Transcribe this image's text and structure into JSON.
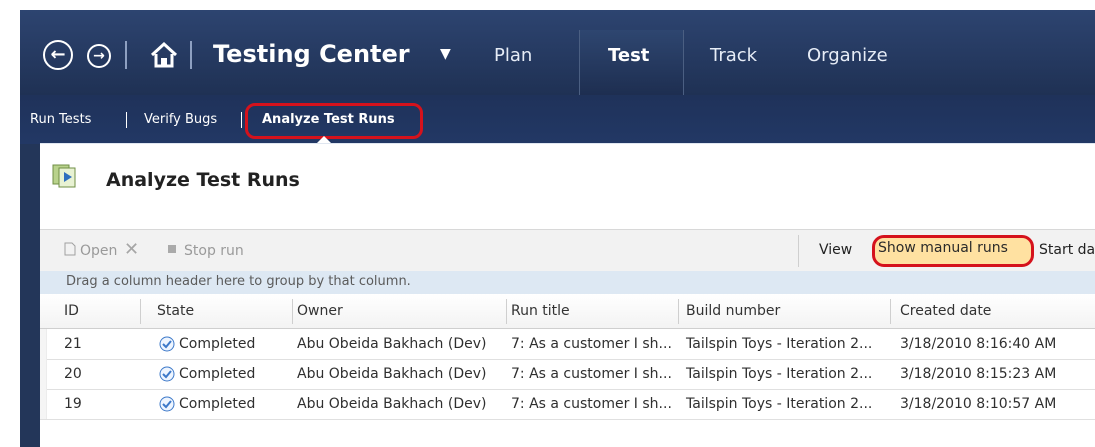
{
  "nav": {
    "title": "Testing Center",
    "tabs": [
      {
        "label": "Plan",
        "active": false
      },
      {
        "label": "Test",
        "active": true
      },
      {
        "label": "Track",
        "active": false
      },
      {
        "label": "Organize",
        "active": false
      }
    ]
  },
  "subnav": {
    "items": [
      {
        "label": "Run Tests",
        "active": false
      },
      {
        "label": "Verify Bugs",
        "active": false
      },
      {
        "label": "Analyze Test Runs",
        "active": true
      }
    ]
  },
  "page": {
    "title": "Analyze Test Runs"
  },
  "toolbar": {
    "open_label": "Open",
    "stop_label": "Stop run",
    "view_label": "View",
    "show_manual_label": "Show manual runs",
    "start_label": "Start dat"
  },
  "group_hint": "Drag a column header here to group by that column.",
  "table": {
    "columns": [
      "ID",
      "State",
      "Owner",
      "Run title",
      "Build number",
      "Created date"
    ],
    "rows": [
      {
        "id": "21",
        "state": "Completed",
        "owner": "Abu Obeida Bakhach (Dev)",
        "run_title": "7: As a customer I sh...",
        "build_number": "Tailspin Toys - Iteration 2...",
        "created_date": "3/18/2010 8:16:40 AM"
      },
      {
        "id": "20",
        "state": "Completed",
        "owner": "Abu Obeida Bakhach (Dev)",
        "run_title": "7: As a customer I sh...",
        "build_number": "Tailspin Toys - Iteration 2...",
        "created_date": "3/18/2010 8:15:23 AM"
      },
      {
        "id": "19",
        "state": "Completed",
        "owner": "Abu Obeida Bakhach (Dev)",
        "run_title": "7: As a customer I sh...",
        "build_number": "Tailspin Toys - Iteration 2...",
        "created_date": "3/18/2010 8:10:57 AM"
      }
    ]
  },
  "colors": {
    "nav_bg": "#233659",
    "accent": "#e8d45e",
    "highlight_ring": "#d5121c",
    "pill_bg": "#ffe1a1",
    "completed_icon": "#3d79c9"
  },
  "icons": [
    "back-arrow-icon",
    "forward-arrow-icon",
    "home-icon",
    "caret-down-icon",
    "analyze-runs-icon",
    "open-icon",
    "delete-icon",
    "stop-icon",
    "completed-check-icon"
  ]
}
